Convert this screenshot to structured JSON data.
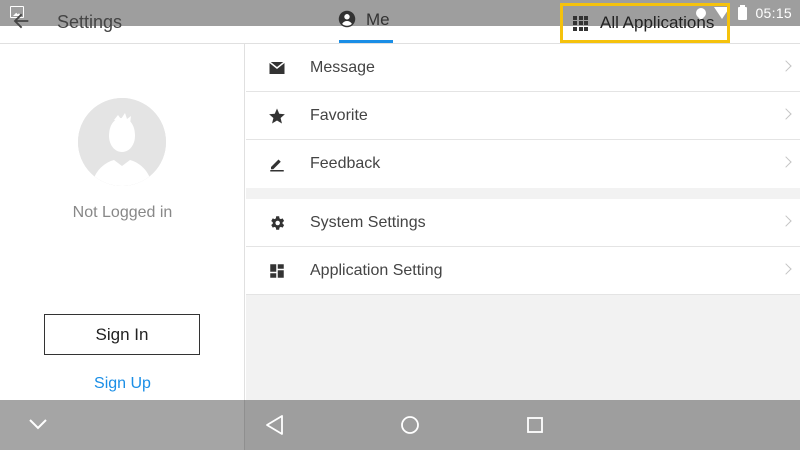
{
  "header": {
    "title": "Settings",
    "tab_me": "Me",
    "all_applications": "All Applications"
  },
  "status_bar": {
    "time": "05:15"
  },
  "profile": {
    "status": "Not Logged in",
    "sign_in": "Sign In",
    "sign_up": "Sign Up"
  },
  "menu": {
    "group1": [
      {
        "label": "Message",
        "icon": "envelope-icon"
      },
      {
        "label": "Favorite",
        "icon": "star-icon"
      },
      {
        "label": "Feedback",
        "icon": "pencil-icon"
      }
    ],
    "group2": [
      {
        "label": "System Settings",
        "icon": "gear-icon"
      },
      {
        "label": "Application Setting",
        "icon": "dashboard-icon"
      }
    ]
  },
  "colors": {
    "accent": "#1a8ee6",
    "highlight": "#f5c20c",
    "bars": "#9e9e9e"
  }
}
